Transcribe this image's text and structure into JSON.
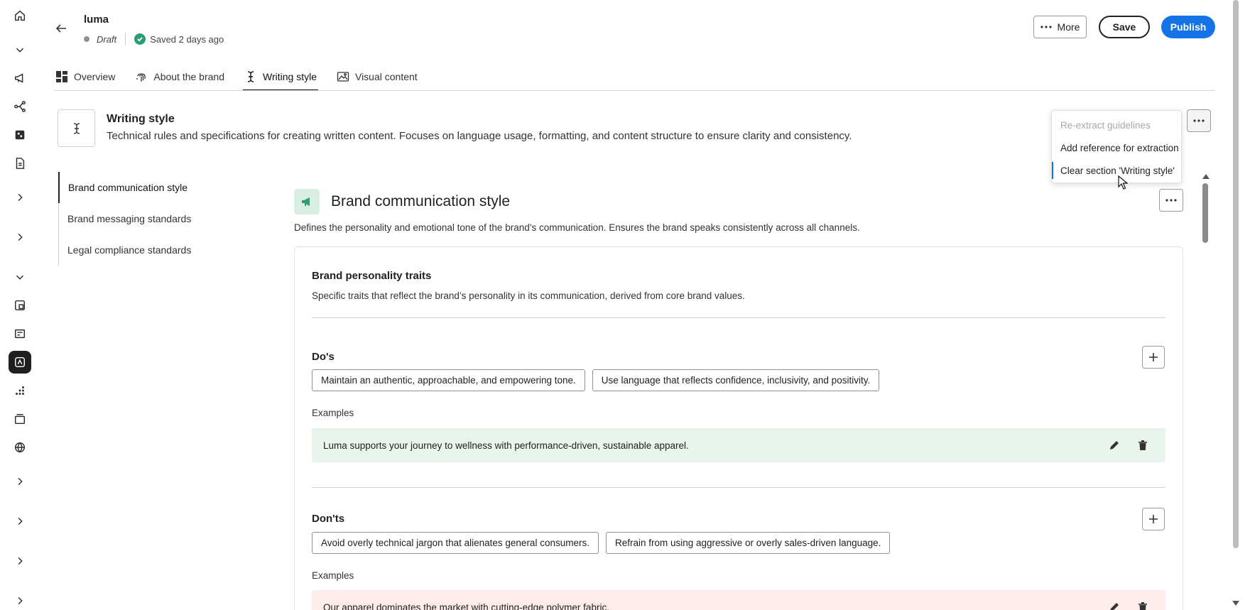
{
  "header": {
    "title": "luma",
    "status": "Draft",
    "saved": "Saved 2 days ago",
    "more_label": "More",
    "save_label": "Save",
    "publish_label": "Publish"
  },
  "tabs": [
    {
      "label": "Overview",
      "icon": "dashboard-icon"
    },
    {
      "label": "About the brand",
      "icon": "fingerprint-icon"
    },
    {
      "label": "Writing style",
      "icon": "text-cursor-icon",
      "active": true
    },
    {
      "label": "Visual content",
      "icon": "image-icon"
    }
  ],
  "section": {
    "title": "Writing style",
    "description": "Technical rules and specifications for creating written content. Focuses on language usage, formatting, and content structure to ensure clarity and consistency."
  },
  "menu": {
    "items": [
      {
        "label": "Re-extract guidelines",
        "disabled": true
      },
      {
        "label": "Add reference for extraction"
      },
      {
        "label": "Clear section 'Writing style'",
        "focused": true
      }
    ]
  },
  "subnav": {
    "items": [
      {
        "label": "Brand communication style",
        "active": true
      },
      {
        "label": "Brand messaging standards"
      },
      {
        "label": "Legal compliance standards"
      }
    ]
  },
  "card": {
    "title": "Brand communication style",
    "description": "Defines the personality and emotional tone of the brand’s communication. Ensures the brand speaks consistently across all channels.",
    "traits_title": "Brand personality traits",
    "traits_description": "Specific traits that reflect the brand’s personality in its communication, derived from core brand values.",
    "dos": {
      "title": "Do's",
      "tags": [
        "Maintain an authentic, approachable, and empowering tone.",
        "Use language that reflects confidence, inclusivity, and positivity."
      ],
      "examples_label": "Examples",
      "example": "Luma supports your journey to wellness with performance-driven, sustainable apparel."
    },
    "donts": {
      "title": "Don'ts",
      "tags": [
        "Avoid overly technical jargon that alienates general consumers.",
        "Refrain from using aggressive or overly sales-driven language."
      ],
      "examples_label": "Examples",
      "example": "Our apparel dominates the market with cutting-edge polymer fabric."
    }
  },
  "colors": {
    "accent": "#1473e6",
    "success": "#2d9d78",
    "good_example_bg": "#e8f4ec",
    "bad_example_bg": "#fdecea",
    "active_rail_bg": "#1f1f1f"
  }
}
